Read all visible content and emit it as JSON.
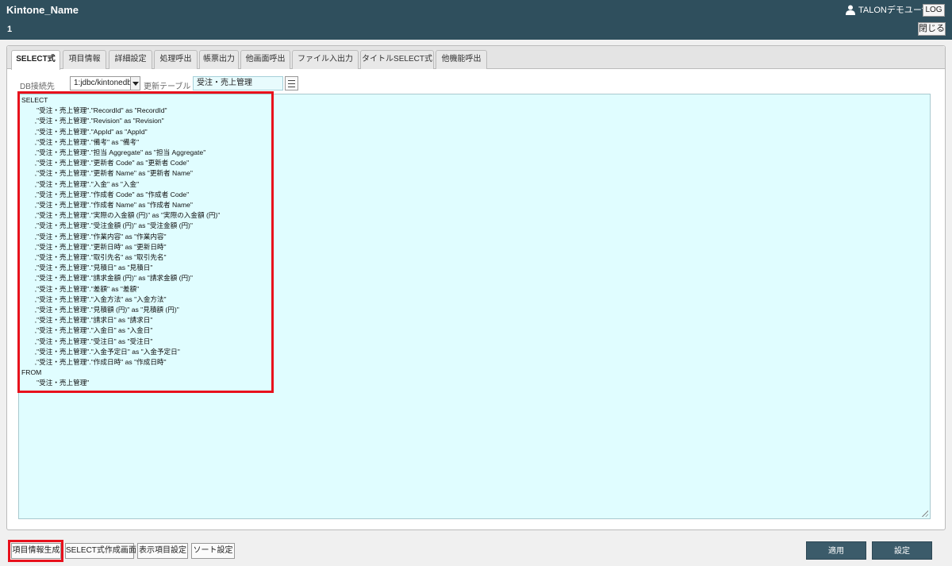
{
  "header": {
    "title": "Kintone_Name",
    "subtitle": "1",
    "user": "TALONデモユーザ",
    "log_label": "LOG",
    "close_label": "閉じる"
  },
  "tabs": [
    {
      "label": "SELECT式",
      "active": true
    },
    {
      "label": "項目情報",
      "active": false
    },
    {
      "label": "詳細設定",
      "active": false
    },
    {
      "label": "処理呼出",
      "active": false
    },
    {
      "label": "帳票出力",
      "active": false
    },
    {
      "label": "他画面呼出",
      "active": false
    },
    {
      "label": "ファイル入出力",
      "active": false
    },
    {
      "label": "タイトルSELECT式",
      "active": false
    },
    {
      "label": "他機能呼出",
      "active": false
    }
  ],
  "db": {
    "label": "DB接続先",
    "value": "1:jdbc/kintonedb"
  },
  "update_table": {
    "label": "更新テーブル",
    "value": "受注・売上管理"
  },
  "sql": [
    "SELECT",
    "        \"受注・売上管理\".\"RecordId\" as \"RecordId\"",
    "       ,\"受注・売上管理\".\"Revision\" as \"Revision\"",
    "       ,\"受注・売上管理\".\"AppId\" as \"AppId\"",
    "       ,\"受注・売上管理\".\"備考\" as \"備考\"",
    "       ,\"受注・売上管理\".\"担当 Aggregate\" as \"担当 Aggregate\"",
    "       ,\"受注・売上管理\".\"更新者 Code\" as \"更新者 Code\"",
    "       ,\"受注・売上管理\".\"更新者 Name\" as \"更新者 Name\"",
    "       ,\"受注・売上管理\".\"入金\" as \"入金\"",
    "       ,\"受注・売上管理\".\"作成者 Code\" as \"作成者 Code\"",
    "       ,\"受注・売上管理\".\"作成者 Name\" as \"作成者 Name\"",
    "       ,\"受注・売上管理\".\"実際の入金額 (円)\" as \"実際の入金額 (円)\"",
    "       ,\"受注・売上管理\".\"受注金額 (円)\" as \"受注金額 (円)\"",
    "       ,\"受注・売上管理\".\"作業内容\" as \"作業内容\"",
    "       ,\"受注・売上管理\".\"更新日時\" as \"更新日時\"",
    "       ,\"受注・売上管理\".\"取引先名\" as \"取引先名\"",
    "       ,\"受注・売上管理\".\"見積日\" as \"見積日\"",
    "       ,\"受注・売上管理\".\"請求金額 (円)\" as \"請求金額 (円)\"",
    "       ,\"受注・売上管理\".\"差額\" as \"差額\"",
    "       ,\"受注・売上管理\".\"入金方法\" as \"入金方法\"",
    "       ,\"受注・売上管理\".\"見積額 (円)\" as \"見積額 (円)\"",
    "       ,\"受注・売上管理\".\"請求日\" as \"請求日\"",
    "       ,\"受注・売上管理\".\"入金日\" as \"入金日\"",
    "       ,\"受注・売上管理\".\"受注日\" as \"受注日\"",
    "       ,\"受注・売上管理\".\"入金予定日\" as \"入金予定日\"",
    "       ,\"受注・売上管理\".\"作成日時\" as \"作成日時\"",
    "FROM",
    "        \"受注・売上管理\""
  ],
  "bottom_buttons": {
    "generate": "項目情報生成",
    "select_screen": "SELECT式作成画面",
    "display_items": "表示項目設定",
    "sort": "ソート設定",
    "apply": "適用",
    "settings": "設定"
  },
  "colors": {
    "header_bg": "#2f4f5d",
    "editor_bg": "#e0fdff",
    "highlight": "#e8111c",
    "primary_button": "#3b5b6a"
  }
}
